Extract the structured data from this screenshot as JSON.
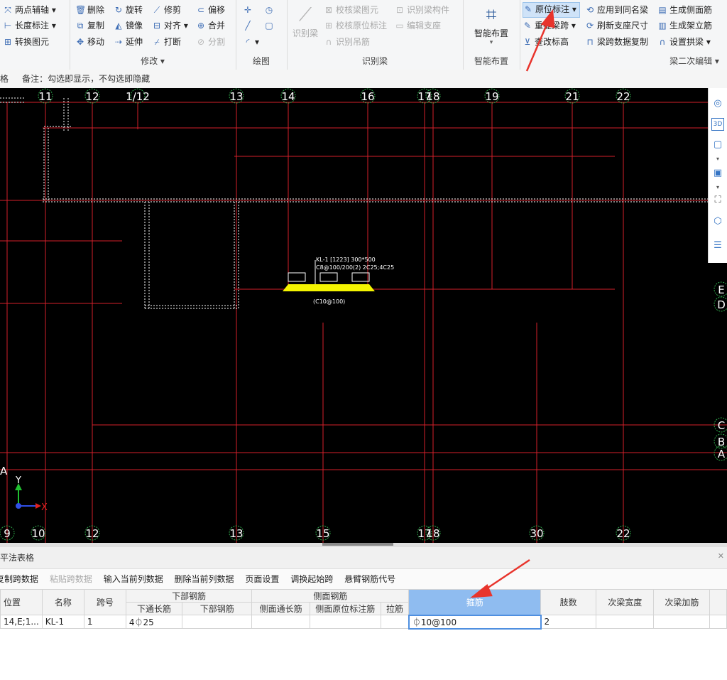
{
  "ribbon": {
    "modify_left": {
      "items": [
        {
          "label": "两点辅轴",
          "icon": "two-point-axis-icon"
        },
        {
          "label": "长度标注",
          "icon": "length-dimension-icon"
        },
        {
          "label": "转换图元",
          "icon": "convert-element-icon"
        }
      ]
    },
    "modify": {
      "title": "修改",
      "items": [
        {
          "label": "删除",
          "icon": "trash-icon",
          "enabled": true
        },
        {
          "label": "旋转",
          "icon": "rotate-icon",
          "enabled": true
        },
        {
          "label": "修剪",
          "icon": "trim-icon",
          "enabled": true
        },
        {
          "label": "偏移",
          "icon": "offset-icon",
          "enabled": true
        },
        {
          "label": "复制",
          "icon": "copy-icon",
          "enabled": true
        },
        {
          "label": "镜像",
          "icon": "mirror-icon",
          "enabled": true
        },
        {
          "label": "对齐",
          "icon": "align-icon",
          "enabled": true
        },
        {
          "label": "合并",
          "icon": "merge-icon",
          "enabled": true
        },
        {
          "label": "移动",
          "icon": "move-icon",
          "enabled": true
        },
        {
          "label": "延伸",
          "icon": "extend-icon",
          "enabled": true
        },
        {
          "label": "打断",
          "icon": "break-icon",
          "enabled": true
        },
        {
          "label": "分割",
          "icon": "split-icon",
          "enabled": false
        }
      ]
    },
    "draw": {
      "title": "绘图"
    },
    "identify_beam": {
      "title": "识别梁",
      "big_button": "识别梁",
      "items": [
        {
          "label": "校核梁图元",
          "icon": "check-beam-icon"
        },
        {
          "label": "识别梁构件",
          "icon": "identify-beam-component-icon"
        },
        {
          "label": "校核原位标注",
          "icon": "check-annotation-icon"
        },
        {
          "label": "编辑支座",
          "icon": "edit-support-icon"
        },
        {
          "label": "识别吊筋",
          "icon": "identify-hanger-icon"
        }
      ]
    },
    "smart_layout": {
      "title": "智能布置",
      "big_button": "智能布置"
    },
    "beam_edit": {
      "title": "梁二次编辑",
      "items": [
        {
          "label": "原位标注",
          "icon": "in-situ-annotation-icon",
          "highlighted": true
        },
        {
          "label": "应用到同名梁",
          "icon": "apply-same-name-icon"
        },
        {
          "label": "生成侧面筋",
          "icon": "generate-side-rebar-icon"
        },
        {
          "label": "重提梁跨",
          "icon": "reextract-span-icon"
        },
        {
          "label": "刷新支座尺寸",
          "icon": "refresh-support-icon"
        },
        {
          "label": "生成架立筋",
          "icon": "generate-erection-rebar-icon"
        },
        {
          "label": "查改标高",
          "icon": "edit-elevation-icon"
        },
        {
          "label": "梁跨数据复制",
          "icon": "copy-span-data-icon"
        },
        {
          "label": "设置拱梁",
          "icon": "set-arch-beam-icon"
        }
      ]
    }
  },
  "note_bar": {
    "prefix": "格",
    "text": "备注：勾选即显示，不勾选即隐藏"
  },
  "canvas": {
    "top_axes": [
      "11",
      "12",
      "1/12",
      "13",
      "14",
      "16",
      "17",
      "18",
      "19",
      "21",
      "22"
    ],
    "bottom_axes": [
      "9",
      "10",
      "12",
      "13",
      "15",
      "17",
      "18",
      "30",
      "22"
    ],
    "right_axes": [
      "E",
      "D",
      "C",
      "B",
      "A"
    ],
    "left_axis": "A",
    "beam_label_line1": "KL-1 [1223] 300*500",
    "beam_label_line2": "C8@100/200(2) 2C25;4C25",
    "beam_label_line3": "(C10@100)",
    "ucs_x": "X",
    "ucs_y": "Y"
  },
  "panel": {
    "title": "平法表格",
    "toolbar": [
      {
        "label": "复制跨数据",
        "enabled": true
      },
      {
        "label": "粘贴跨数据",
        "enabled": false
      },
      {
        "label": "输入当前列数据",
        "enabled": true
      },
      {
        "label": "删除当前列数据",
        "enabled": true
      },
      {
        "label": "页面设置",
        "enabled": true
      },
      {
        "label": "调换起始跨",
        "enabled": true
      },
      {
        "label": "悬臂钢筋代号",
        "enabled": true
      }
    ],
    "headers": {
      "position": "位置",
      "name": "名称",
      "span": "跨号",
      "bottom_rebar": "下部钢筋",
      "bottom_through": "下通长筋",
      "bottom_rebar_sub": "下部钢筋",
      "side_rebar": "侧面钢筋",
      "side_through": "侧面通长筋",
      "side_in_situ": "侧面原位标注筋",
      "tie": "拉筋",
      "stirrup": "箍筋",
      "legs": "肢数",
      "secondary_width": "次梁宽度",
      "secondary_add": "次梁加筋"
    },
    "rows": [
      {
        "position": "14,E;1...",
        "name": "KL-1",
        "span": "1",
        "bottom_through": "4⏀25",
        "bottom_rebar": "",
        "side_through": "",
        "side_in_situ": "",
        "tie": "",
        "stirrup": "⏀10@100",
        "legs": "2",
        "secondary_width": "",
        "secondary_add": ""
      }
    ]
  },
  "colors": {
    "canvas_bg": "#000000",
    "axis_line": "#d4202a",
    "axis_bubble": "#2ea84a",
    "beam_fill": "#f4f400",
    "annotation_arrow": "#e8342c",
    "selected_header": "#8fbcf0"
  }
}
